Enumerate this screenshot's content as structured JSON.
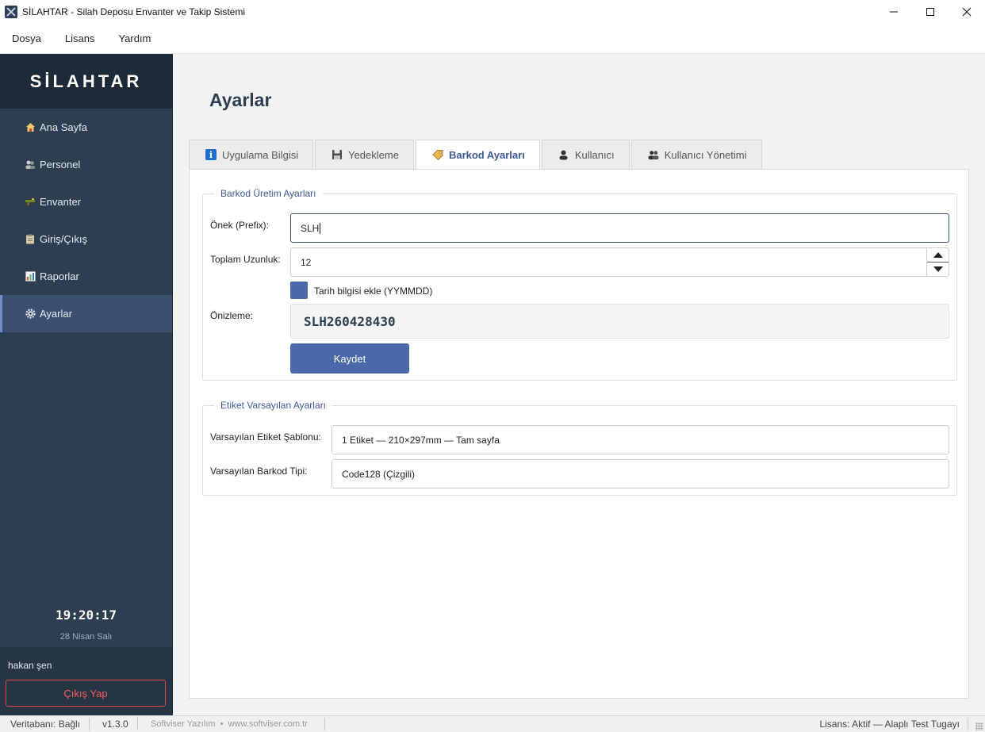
{
  "window": {
    "title": "SİLAHTAR - Silah Deposu Envanter ve Takip Sistemi"
  },
  "menu": [
    "Dosya",
    "Lisans",
    "Yardım"
  ],
  "sidebar": {
    "brand": "SİLAHTAR",
    "items": [
      {
        "label": "Ana Sayfa",
        "icon": "home-icon",
        "active": false
      },
      {
        "label": "Personel",
        "icon": "people-icon",
        "active": false
      },
      {
        "label": "Envanter",
        "icon": "weapon-icon",
        "active": false
      },
      {
        "label": "Giriş/Çıkış",
        "icon": "clipboard-icon",
        "active": false
      },
      {
        "label": "Raporlar",
        "icon": "chart-icon",
        "active": false
      },
      {
        "label": "Ayarlar",
        "icon": "gear-icon",
        "active": true
      }
    ],
    "clock": "19:20:17",
    "date": "28 Nisan Salı",
    "user": "hakan şen",
    "logout": "Çıkış Yap"
  },
  "main": {
    "title": "Ayarlar",
    "tabs": [
      {
        "label": "Uygulama Bilgisi",
        "icon": "info-icon",
        "active": false
      },
      {
        "label": "Yedekleme",
        "icon": "floppy-icon",
        "active": false
      },
      {
        "label": "Barkod Ayarları",
        "icon": "tag-icon",
        "active": true
      },
      {
        "label": "Kullanıcı",
        "icon": "user-icon",
        "active": false
      },
      {
        "label": "Kullanıcı Yönetimi",
        "icon": "users-icon",
        "active": false
      }
    ],
    "barcode": {
      "title": "Barkod Üretim Ayarları",
      "prefix_label": "Önek (Prefix):",
      "prefix_value": "SLH",
      "length_label": "Toplam Uzunluk:",
      "length_value": "12",
      "date_checkbox_label": "Tarih bilgisi ekle (YYMMDD)",
      "date_checked": true,
      "preview_label": "Önizleme:",
      "preview_value": "SLH260428430",
      "save_label": "Kaydet"
    },
    "label_defaults": {
      "title": "Etiket Varsayılan Ayarları",
      "template_label": "Varsayılan Etiket Şablonu:",
      "template_value": "1 Etiket — 210×297mm — Tam sayfa",
      "barcode_type_label": "Varsayılan Barkod Tipi:",
      "barcode_type_value": "Code128 (Çizgili)"
    }
  },
  "status": {
    "db": "Veritabanı: Bağlı",
    "version": "v1.3.0",
    "company": "Softviser Yazılım  •  www.softviser.com.tr",
    "license": "Lisans: Aktif — Alaplı Test Tugayı"
  },
  "colors": {
    "sidebar": "#2c3e50",
    "brand_bg": "#1d2b38",
    "accent": "#4a69a8",
    "title": "#2c3e50",
    "danger": "#e04848"
  }
}
